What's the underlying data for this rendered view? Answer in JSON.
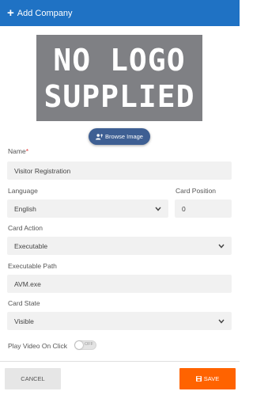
{
  "header": {
    "title": "Add Company",
    "icon": "plus-icon"
  },
  "logo": {
    "line1": "NO LOGO",
    "line2": "SUPPLIED"
  },
  "browse_button": {
    "label": "Browse Image",
    "icon": "user-upload-icon"
  },
  "name": {
    "label": "Name",
    "required_mark": "*",
    "value": "Visitor Registration"
  },
  "language": {
    "label": "Language",
    "value": "English"
  },
  "card_position": {
    "label": "Card Position",
    "value": "0"
  },
  "card_action": {
    "label": "Card Action",
    "value": "Executable"
  },
  "executable_path": {
    "label": "Executable Path",
    "value": "AVM.exe"
  },
  "card_state": {
    "label": "Card State",
    "value": "Visible"
  },
  "play_video": {
    "label": "Play Video On Click",
    "toggle_text": "OFF"
  },
  "footer": {
    "cancel_label": "CANCEL",
    "save_label": "SAVE",
    "save_icon": "save-icon"
  },
  "colors": {
    "header": "#1f72c4",
    "save": "#ff6300",
    "browse": "#3e5f93"
  }
}
